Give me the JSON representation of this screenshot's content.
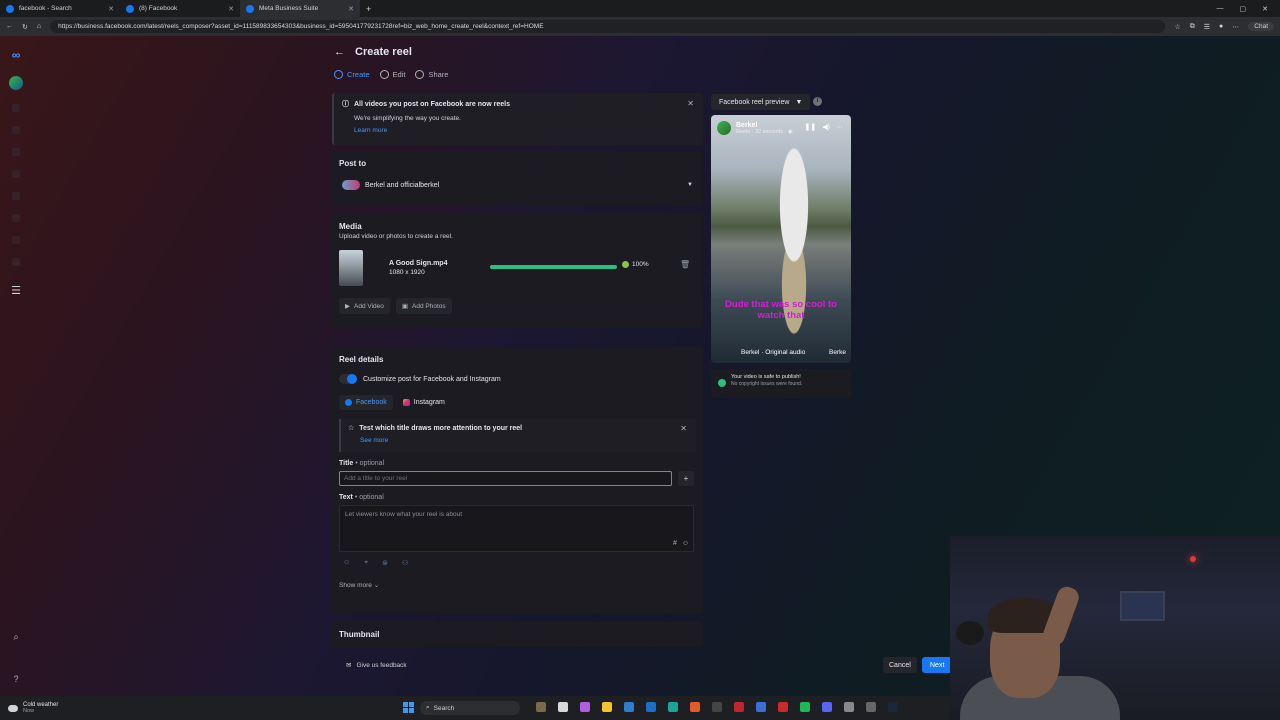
{
  "browser": {
    "tabs": [
      {
        "title": "facebook - Search",
        "active": false
      },
      {
        "title": "(8) Facebook",
        "active": false
      },
      {
        "title": "Meta Business Suite",
        "active": true
      }
    ],
    "url": "https://business.facebook.com/latest/reels_composer?asset_id=111589833654303&business_id=595041779231728ref=biz_web_home_create_reel&context_ref=HOME",
    "chat_label": "Chat"
  },
  "header": {
    "title": "Create reel"
  },
  "steps": [
    {
      "label": "Create",
      "active": true
    },
    {
      "label": "Edit",
      "active": false
    },
    {
      "label": "Share",
      "active": false
    }
  ],
  "notice": {
    "title": "All videos you post on Facebook are now reels",
    "text": "We're simplifying the way you create.",
    "link": "Learn more"
  },
  "post_to": {
    "heading": "Post to",
    "value": "Berkel and officialberkel"
  },
  "media": {
    "heading": "Media",
    "description": "Upload video or photos to create a reel.",
    "file": {
      "name": "A Good Sign.mp4",
      "dimensions": "1080 x 1920",
      "progress_pct": 100,
      "progress_label": "100%"
    },
    "add_video": "Add Video",
    "add_photos": "Add Photos"
  },
  "details": {
    "heading": "Reel details",
    "customize_label": "Customize post for Facebook and Instagram",
    "tabs": [
      "Facebook",
      "Instagram"
    ],
    "test_title": "Test which title draws more attention to your reel",
    "see_more": "See more",
    "title_label": "Title",
    "optional": "• optional",
    "title_placeholder": "Add a title to your reel",
    "text_label": "Text",
    "text_placeholder": "Let viewers know what your reel is about",
    "show_more": "Show more",
    "thumbnail": "Thumbnail"
  },
  "footer": {
    "feedback": "Give us feedback",
    "cancel": "Cancel",
    "next": "Next"
  },
  "preview": {
    "dropdown": "Facebook reel preview",
    "account": "Berkel",
    "meta": "Reels · 32 seconds · ◉",
    "caption": "Dude that was so cool to watch that",
    "audio": "Berkel · Original audio",
    "audio_tag": "Berke",
    "safe_title": "Your video is safe to publish!",
    "safe_sub": "No copyright issues were found."
  },
  "taskbar": {
    "weather_title": "Cold weather",
    "weather_sub": "Now",
    "search": "Search"
  },
  "colors": {
    "accent": "#1877f2",
    "link": "#4599ff",
    "progress": "#2dbf7f"
  }
}
